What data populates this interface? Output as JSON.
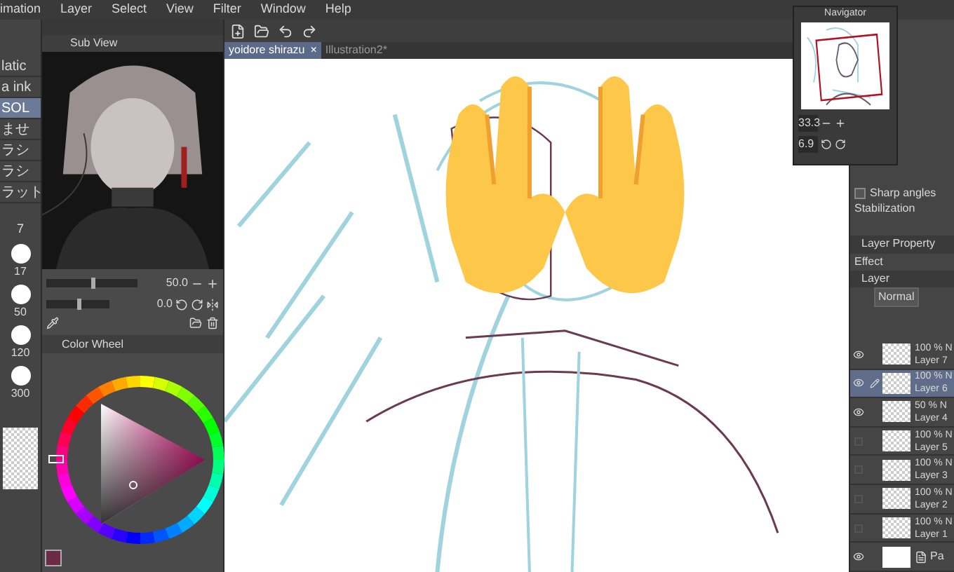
{
  "menu": [
    "imation",
    "Layer",
    "Select",
    "View",
    "Filter",
    "Window",
    "Help"
  ],
  "tool_strip": [
    {
      "label": "latic",
      "selected": false
    },
    {
      "label": "a ink",
      "selected": false
    },
    {
      "label": "SOL",
      "selected": true
    },
    {
      "label": "ませ",
      "selected": false
    },
    {
      "label": "ラシ",
      "selected": false
    },
    {
      "label": "ラシ",
      "selected": false
    },
    {
      "label": "ラット",
      "selected": false
    }
  ],
  "brush_sizes": {
    "header": "7",
    "sizes": [
      "17",
      "50",
      "120",
      "300"
    ]
  },
  "sub_view": {
    "title": "Sub View",
    "zoom": "50.0",
    "zoom_slider": {
      "level": 0.5
    },
    "angle": "0.0",
    "angle_slider": {
      "level": 0.5
    }
  },
  "color_wheel": {
    "title": "Color Wheel"
  },
  "tabs": [
    {
      "label": "yoidore shirazu",
      "selected": true,
      "close": "×"
    },
    {
      "label": "Illustration2*",
      "selected": false
    }
  ],
  "navigator": {
    "title": "Navigator",
    "zoom": "33.3",
    "angle": "6.9"
  },
  "tool_property": {
    "sharp_angles": {
      "label": "Sharp angles",
      "checked": false
    },
    "section": "Stabilization"
  },
  "layer_panel": {
    "property_tab": "Layer Property",
    "effect": "Effect",
    "layer_tab": "Layer",
    "blend_mode": "Normal",
    "layers": [
      {
        "kind": "layer",
        "mode": "100 % N",
        "name": "Layer 7",
        "visible": true,
        "selected": false
      },
      {
        "kind": "layer",
        "mode": "100 % N",
        "name": "Layer 6",
        "visible": true,
        "selected": true
      },
      {
        "kind": "layer",
        "mode": "50 % N",
        "name": "Layer 4",
        "visible": true,
        "selected": false
      },
      {
        "kind": "layer",
        "mode": "100 % N",
        "name": "Layer 5",
        "visible": false,
        "selected": false
      },
      {
        "kind": "layer",
        "mode": "100 % N",
        "name": "Layer 3",
        "visible": false,
        "selected": false
      },
      {
        "kind": "layer",
        "mode": "100 % N",
        "name": "Layer 2",
        "visible": false,
        "selected": false
      },
      {
        "kind": "layer",
        "mode": "100 % N",
        "name": "Layer 1",
        "visible": false,
        "selected": false
      },
      {
        "kind": "paper",
        "name": "Pa",
        "visible": true,
        "selected": false
      }
    ]
  }
}
